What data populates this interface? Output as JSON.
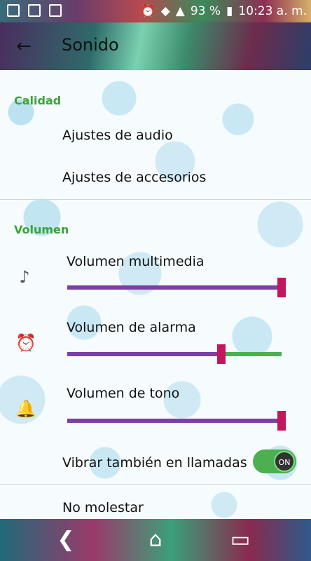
{
  "status_bar": {
    "battery": "93 %",
    "time": "10:23 a. m.",
    "notification_icons": [
      "fk-icon",
      "image-icon",
      "phone-icon"
    ],
    "system_icons": [
      "alarm-icon",
      "wifi-icon",
      "signal-icon",
      "battery-icon"
    ]
  },
  "app_bar": {
    "title": "Sonido",
    "back_icon": "arrow-back-icon"
  },
  "sections": {
    "calidad": {
      "header": "Calidad",
      "items": [
        "Ajustes de audio",
        "Ajustes de accesorios"
      ]
    },
    "volumen": {
      "header": "Volumen",
      "sliders": [
        {
          "label": "Volumen multimedia",
          "icon": "music-note-icon",
          "level": 1.0
        },
        {
          "label": "Volumen de alarma",
          "icon": "alarm-clock-icon",
          "level": 0.72
        },
        {
          "label": "Volumen de tono",
          "icon": "bell-icon",
          "level": 1.0
        }
      ],
      "vibrate": {
        "label": "Vibrar también en llamadas",
        "state": "ON"
      },
      "dnd": {
        "label": "No molestar"
      }
    }
  },
  "nav_bar": {
    "buttons": [
      "back-icon",
      "home-icon",
      "recents-icon"
    ]
  },
  "colors": {
    "section_header": "#3aa33a",
    "slider_fill": "#7b3fa5",
    "slider_track": "#4caf50",
    "slider_thumb": "#c2185b"
  }
}
